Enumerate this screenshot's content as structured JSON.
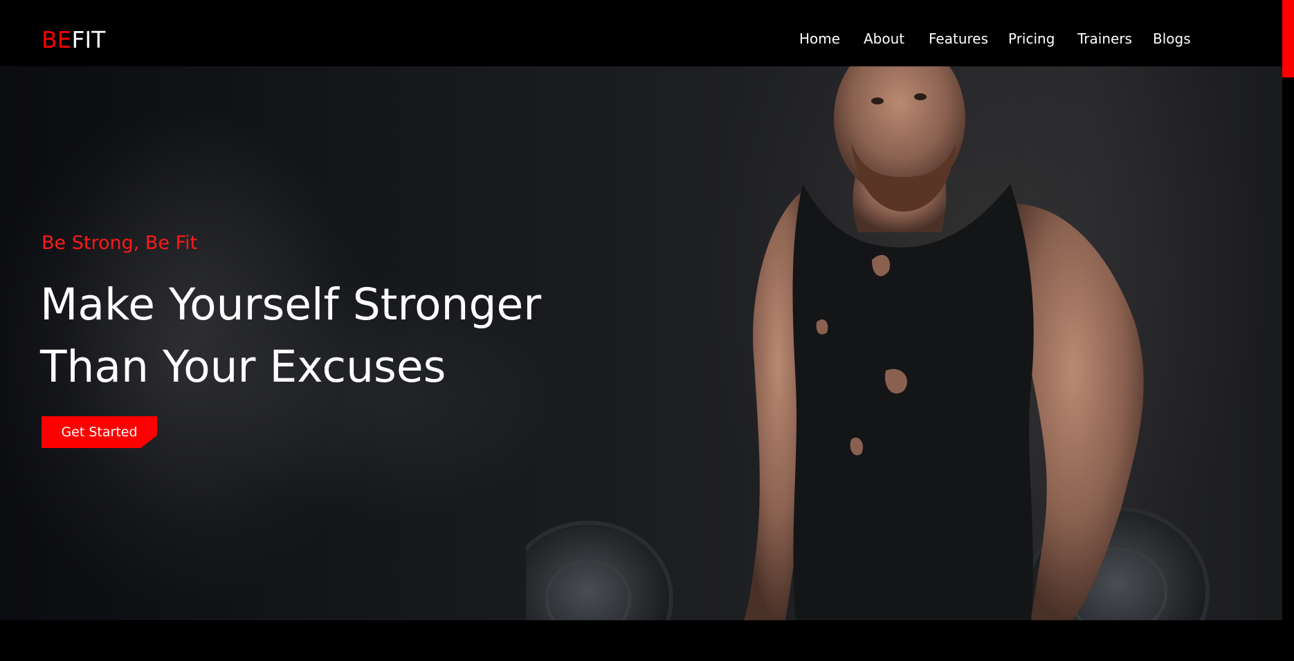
{
  "brand": {
    "logo_accent": "BE",
    "logo_rest": "FIT",
    "accent_color": "#ff0000"
  },
  "nav": {
    "items": [
      {
        "label": "Home"
      },
      {
        "label": "About"
      },
      {
        "label": "Features"
      },
      {
        "label": "Pricing"
      },
      {
        "label": "Trainers"
      },
      {
        "label": "Blogs"
      }
    ]
  },
  "hero": {
    "tagline": "Be Strong, Be Fit",
    "headline_line1": "Make Yourself Stronger",
    "headline_line2": "Than Your Excuses",
    "cta_label": "Get Started"
  }
}
